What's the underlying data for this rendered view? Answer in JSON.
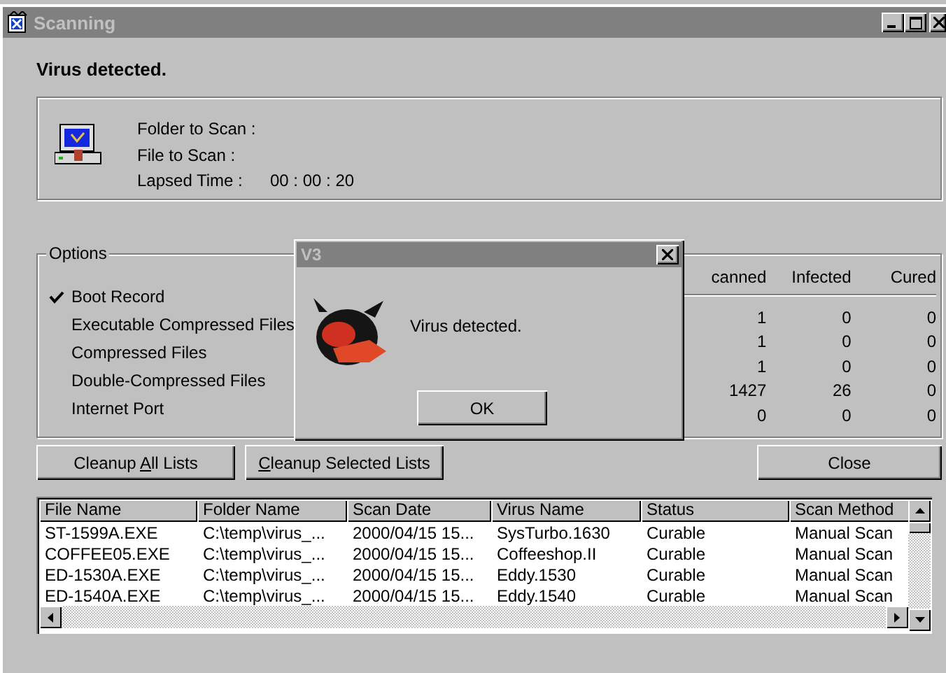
{
  "window": {
    "title": "Scanning"
  },
  "status_message": "Virus detected.",
  "scan_info": [
    {
      "label": "Folder to Scan :"
    },
    {
      "label": "File to Scan :"
    },
    {
      "label": "Lapsed Time :",
      "value": "00 : 00 : 20"
    }
  ],
  "options": {
    "title": "Options",
    "items": [
      {
        "label": "Boot Record",
        "checked": true
      },
      {
        "label": "Executable Compressed Files",
        "checked": false
      },
      {
        "label": "Compressed Files",
        "checked": false
      },
      {
        "label": "Double-Compressed Files",
        "checked": false
      },
      {
        "label": "Internet Port",
        "checked": false
      }
    ]
  },
  "stats": {
    "columns": [
      "canned",
      "Infected",
      "Cured"
    ],
    "rows": [
      [
        "1",
        "0",
        "0"
      ],
      [
        "1",
        "0",
        "0"
      ],
      [
        "1",
        "0",
        "0"
      ],
      [
        "1427",
        "26",
        "0"
      ],
      [
        "0",
        "0",
        "0"
      ]
    ]
  },
  "buttons": [
    {
      "parts": [
        {
          "text": "Cleanup ",
          "underline": false
        },
        {
          "text": "A",
          "underline": true
        },
        {
          "text": "ll Lists",
          "underline": false
        }
      ]
    },
    {
      "parts": [
        {
          "text": "C",
          "underline": true
        },
        {
          "text": "leanup Selected Lists",
          "underline": false
        }
      ]
    },
    {
      "parts": [
        {
          "text": "Close",
          "underline": false
        }
      ]
    }
  ],
  "results": {
    "columns": [
      "File Name",
      "Folder Name",
      "Scan Date",
      "Virus Name",
      "Status",
      "Scan Method"
    ],
    "rows": [
      [
        "ST-1599A.EXE",
        "C:\\temp\\virus_...",
        "2000/04/15 15...",
        "SysTurbo.1630",
        "Curable",
        "Manual Scan"
      ],
      [
        "COFFEE05.EXE",
        "C:\\temp\\virus_...",
        "2000/04/15 15...",
        "Coffeeshop.II",
        "Curable",
        "Manual Scan"
      ],
      [
        "ED-1530A.EXE",
        "C:\\temp\\virus_...",
        "2000/04/15 15...",
        "Eddy.1530",
        "Curable",
        "Manual Scan"
      ],
      [
        "ED-1540A.EXE",
        "C:\\temp\\virus_...",
        "2000/04/15 15...",
        "Eddy.1540",
        "Curable",
        "Manual Scan"
      ]
    ]
  },
  "dialog": {
    "title": "V3",
    "message": "Virus detected.",
    "button": "OK"
  }
}
